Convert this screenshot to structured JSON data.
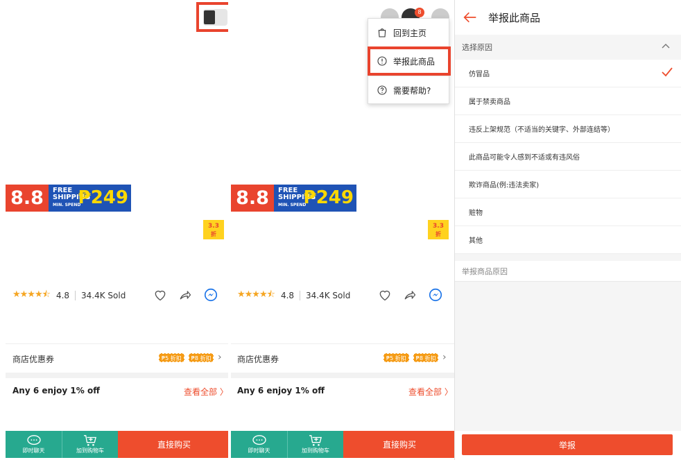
{
  "promo": {
    "big": "8.8",
    "free": "FREE",
    "shipping": "SHIPPING",
    "min": "MIN. SPEND",
    "price": "₱249"
  },
  "discount": {
    "value": "3.3",
    "unit": "折"
  },
  "rating": {
    "stars": "★★★★⯪",
    "value": "4.8",
    "sold": "34.4K Sold"
  },
  "voucher": {
    "label": "商店优惠券",
    "tag1": "₱5 折扣",
    "tag2": "₱8 折扣"
  },
  "bundle": {
    "label": "Any 6 enjoy 1% off",
    "see_all": "查看全部 〉"
  },
  "bottom": {
    "chat": "即时聊天",
    "cart": "加到购物车",
    "buy": "直接购买"
  },
  "menu": {
    "cart_count": "8",
    "home": "回到主页",
    "report": "举报此商品",
    "help": "需要帮助?"
  },
  "report": {
    "title": "举报此商品",
    "section": "选择原因",
    "reasons": [
      "仿冒品",
      "属于禁卖商品",
      "违反上架规范（不适当的关键字、外部连结等）",
      "此商品可能令人感到不适或有违风俗",
      "欺诈商品(例:违法卖家)",
      "赃物",
      "其他"
    ],
    "reason_label": "举报商品原因",
    "submit": "举报"
  },
  "colors": {
    "accent": "#ee4d2d",
    "teal": "#27a98f",
    "highlight": "#e9442e"
  }
}
